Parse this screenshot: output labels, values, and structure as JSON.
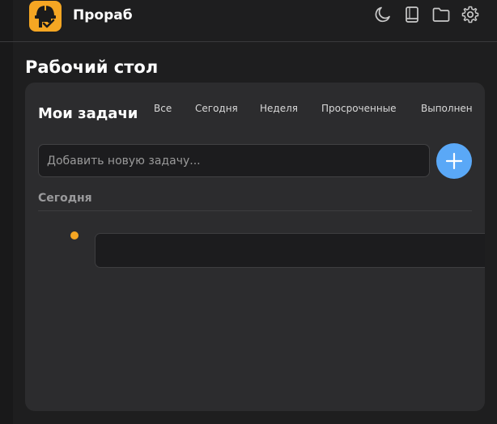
{
  "app": {
    "title": "Прораб",
    "logo_icon": "helmet-check-icon",
    "accent_color": "#f5a623"
  },
  "toolbar": {
    "icons": [
      "moon-icon",
      "book-icon",
      "folder-icon",
      "gear-icon"
    ]
  },
  "page": {
    "title": "Рабочий стол"
  },
  "tasks_widget": {
    "title": "Мои задачи",
    "filters": [
      "Все",
      "Сегодня",
      "Неделя",
      "Просроченные",
      "Выполнен"
    ],
    "input_placeholder": "Добавить новую задачу...",
    "add_button_icon": "plus-icon",
    "add_button_color": "#5aa8f7",
    "section_heading": "Сегодня",
    "task_dot_color": "#f5a623"
  }
}
